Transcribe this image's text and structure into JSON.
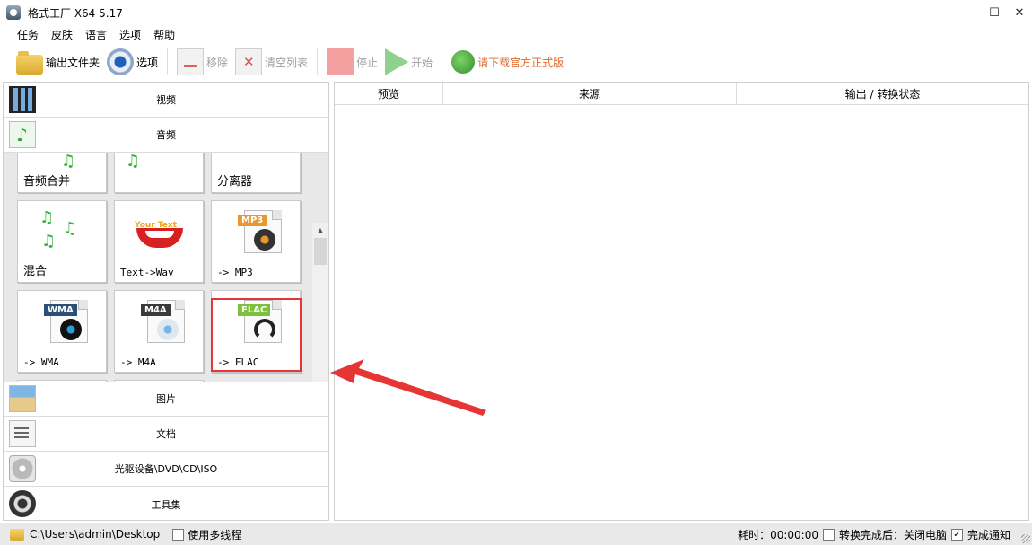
{
  "window": {
    "title": "格式工厂 X64 5.17",
    "controls": {
      "minimize": "—",
      "maximize": "☐",
      "close": "✕"
    }
  },
  "menu": [
    "任务",
    "皮肤",
    "语言",
    "选项",
    "帮助"
  ],
  "toolbar": {
    "output_folder": "输出文件夹",
    "options": "选项",
    "remove": "移除",
    "clear_list": "清空列表",
    "stop": "停止",
    "start": "开始",
    "download_official": "请下载官方正式版"
  },
  "categories": {
    "video": "视频",
    "audio": "音频",
    "picture": "图片",
    "document": "文档",
    "disc": "光驱设备\\DVD\\CD\\ISO",
    "tools": "工具集"
  },
  "audio_tiles": {
    "merge": "音频合并",
    "splitter": "分离器",
    "mix": "混合",
    "text_to_wav": "Text->Wav",
    "to_mp3": "-> MP3",
    "to_wma": "-> WMA",
    "to_m4a": "-> M4A",
    "to_flac": "-> FLAC",
    "tags": {
      "mp3": "MP3",
      "wma": "WMA",
      "m4a": "M4A",
      "flac": "FLAC",
      "your_text": "Your Text"
    }
  },
  "file_list": {
    "columns": [
      "预览",
      "来源",
      "输出 / 转换状态"
    ]
  },
  "statusbar": {
    "output_path": "C:\\Users\\admin\\Desktop",
    "multithread_label": "使用多线程",
    "multithread_checked": false,
    "elapsed": "耗时：00:00:00",
    "after_complete_label": "转换完成后：关闭电脑",
    "after_complete_checked": false,
    "notify_label": "完成通知",
    "notify_checked": true
  },
  "colors": {
    "accent_download": "#e0682a",
    "highlight_box": "#e53535",
    "annotation_arrow": "#e53535",
    "tag_mp3": "#e8972a",
    "tag_wma": "#2c4f77",
    "tag_m4a": "#3a3a3a",
    "tag_flac": "#7cc13a"
  },
  "icons": {
    "output_folder": "folder-icon",
    "options": "options-icon",
    "remove": "remove-icon",
    "clear_list": "clear-list-icon",
    "stop": "stop-icon",
    "start": "start-icon",
    "download": "globe-icon"
  }
}
